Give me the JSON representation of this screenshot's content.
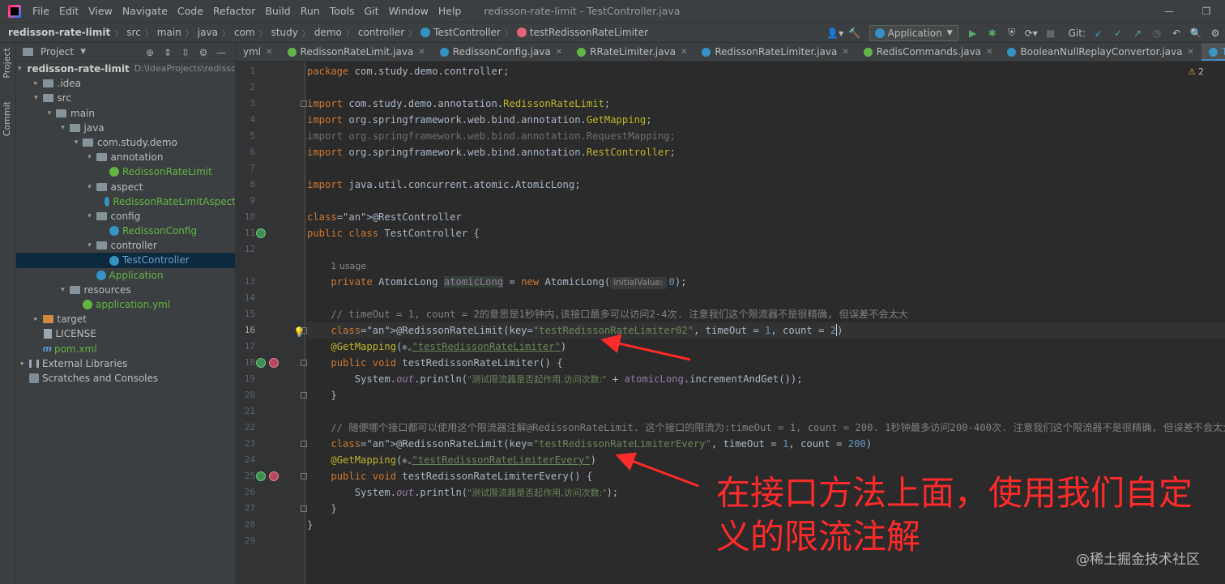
{
  "menubar": {
    "items": [
      "File",
      "Edit",
      "View",
      "Navigate",
      "Code",
      "Refactor",
      "Build",
      "Run",
      "Tools",
      "Git",
      "Window",
      "Help"
    ],
    "window_title": "redisson-rate-limit - TestController.java",
    "controls": [
      "—",
      "❐"
    ]
  },
  "breadcrumbs": [
    "redisson-rate-limit",
    "src",
    "main",
    "java",
    "com",
    "study",
    "demo",
    "controller",
    "TestController",
    "testRedissonRateLimiter"
  ],
  "toolbar": {
    "run_config": "Application",
    "git_label": "Git:"
  },
  "left_stripe": {
    "project_tab": "Project",
    "commit_tab": "Commit"
  },
  "project_panel": {
    "title": "Project",
    "tree": [
      {
        "label": "redisson-rate-limit",
        "extra": "D:\\IdeaProjects\\redisson-rat",
        "depth": 0,
        "arrow": "▾",
        "icon": "folder",
        "style": "bold"
      },
      {
        "label": ".idea",
        "depth": 1,
        "arrow": "▸",
        "icon": "folder"
      },
      {
        "label": "src",
        "depth": 1,
        "arrow": "▾",
        "icon": "folder"
      },
      {
        "label": "main",
        "depth": 2,
        "arrow": "▾",
        "icon": "folder"
      },
      {
        "label": "java",
        "depth": 3,
        "arrow": "▾",
        "icon": "folder"
      },
      {
        "label": "com.study.demo",
        "depth": 4,
        "arrow": "▾",
        "icon": "folder"
      },
      {
        "label": "annotation",
        "depth": 5,
        "arrow": "▾",
        "icon": "folder"
      },
      {
        "label": "RedissonRateLimit",
        "depth": 6,
        "arrow": "",
        "icon": "anno",
        "style": "green"
      },
      {
        "label": "aspect",
        "depth": 5,
        "arrow": "▾",
        "icon": "folder"
      },
      {
        "label": "RedissonRateLimitAspect",
        "depth": 6,
        "arrow": "",
        "icon": "cls",
        "style": "green"
      },
      {
        "label": "config",
        "depth": 5,
        "arrow": "▾",
        "icon": "folder"
      },
      {
        "label": "RedissonConfig",
        "depth": 6,
        "arrow": "",
        "icon": "cls",
        "style": "green"
      },
      {
        "label": "controller",
        "depth": 5,
        "arrow": "▾",
        "icon": "folder"
      },
      {
        "label": "TestController",
        "depth": 6,
        "arrow": "",
        "icon": "cls",
        "style": "cls",
        "selected": true
      },
      {
        "label": "Application",
        "depth": 5,
        "arrow": "",
        "icon": "cls",
        "style": "green"
      },
      {
        "label": "resources",
        "depth": 3,
        "arrow": "▾",
        "icon": "folder"
      },
      {
        "label": "application.yml",
        "depth": 4,
        "arrow": "",
        "icon": "yml",
        "style": "green"
      },
      {
        "label": "target",
        "depth": 1,
        "arrow": "▸",
        "icon": "folder-orange"
      },
      {
        "label": "LICENSE",
        "depth": 1,
        "arrow": "",
        "icon": "file"
      },
      {
        "label": "pom.xml",
        "depth": 1,
        "arrow": "",
        "icon": "m",
        "style": "green"
      },
      {
        "label": "External Libraries",
        "depth": 0,
        "arrow": "▸",
        "icon": "lib"
      },
      {
        "label": "Scratches and Consoles",
        "depth": 0,
        "arrow": "",
        "icon": "scratch"
      }
    ]
  },
  "editor_tabs": [
    {
      "label": "yml",
      "icon": "",
      "active": false
    },
    {
      "label": "RedissonRateLimit.java",
      "icon": "anno",
      "active": false
    },
    {
      "label": "RedissonConfig.java",
      "icon": "cls",
      "active": false
    },
    {
      "label": "RRateLimiter.java",
      "icon": "iface",
      "active": false
    },
    {
      "label": "RedissonRateLimiter.java",
      "icon": "cls",
      "active": false
    },
    {
      "label": "RedisCommands.java",
      "icon": "iface",
      "active": false
    },
    {
      "label": "BooleanNullReplayConvertor.java",
      "icon": "cls",
      "active": false
    },
    {
      "label": "TestController.java",
      "icon": "cls",
      "active": true
    }
  ],
  "editor": {
    "warning_count": "2",
    "current_line": 16,
    "usage_hint": "1 usage",
    "param_hint": "initialValue:",
    "lines": [
      "package com.study.demo.controller;",
      "",
      "import com.study.demo.annotation.RedissonRateLimit;",
      "import org.springframework.web.bind.annotation.GetMapping;",
      "import org.springframework.web.bind.annotation.RequestMapping;",
      "import org.springframework.web.bind.annotation.RestController;",
      "",
      "import java.util.concurrent.atomic.AtomicLong;",
      "",
      "@RestController",
      "public class TestController {",
      "",
      "    private AtomicLong atomicLong = new AtomicLong(0);",
      "",
      "    // timeOut = 1, count = 2的意思是1秒钟内,该接口最多可以访问2-4次. 注意我们这个限流器不是很精确, 但误差不会太大",
      "    @RedissonRateLimit(key=\"testRedissonRateLimiter02\", timeOut = 1, count = 2)",
      "    @GetMapping(\"testRedissonRateLimiter\")",
      "    public void testRedissonRateLimiter() {",
      "        System.out.println(\"测试限流器是否起作用,访问次数:\" + atomicLong.incrementAndGet());",
      "    }",
      "",
      "    // 随便哪个接口都可以使用这个限流器注解@RedissonRateLimit. 这个接口的限流为:timeOut = 1, count = 200. 1秒钟最多访问200-400次. 注意我们这个限流器不是很精确, 但误差不会太大",
      "    @RedissonRateLimit(key=\"testRedissonRateLimiterEvery\", timeOut = 1, count = 200)",
      "    @GetMapping(\"testRedissonRateLimiterEvery\")",
      "    public void testRedissonRateLimiterEvery() {",
      "        System.out.println(\"测试限流器是否起作用,访问次数:\");",
      "    }",
      "}",
      ""
    ]
  },
  "annotation": {
    "text": "在接口方法上面，使用我们自定义的限流注解",
    "color": "#ff2a2a"
  },
  "watermark": "@稀土掘金技术社区"
}
